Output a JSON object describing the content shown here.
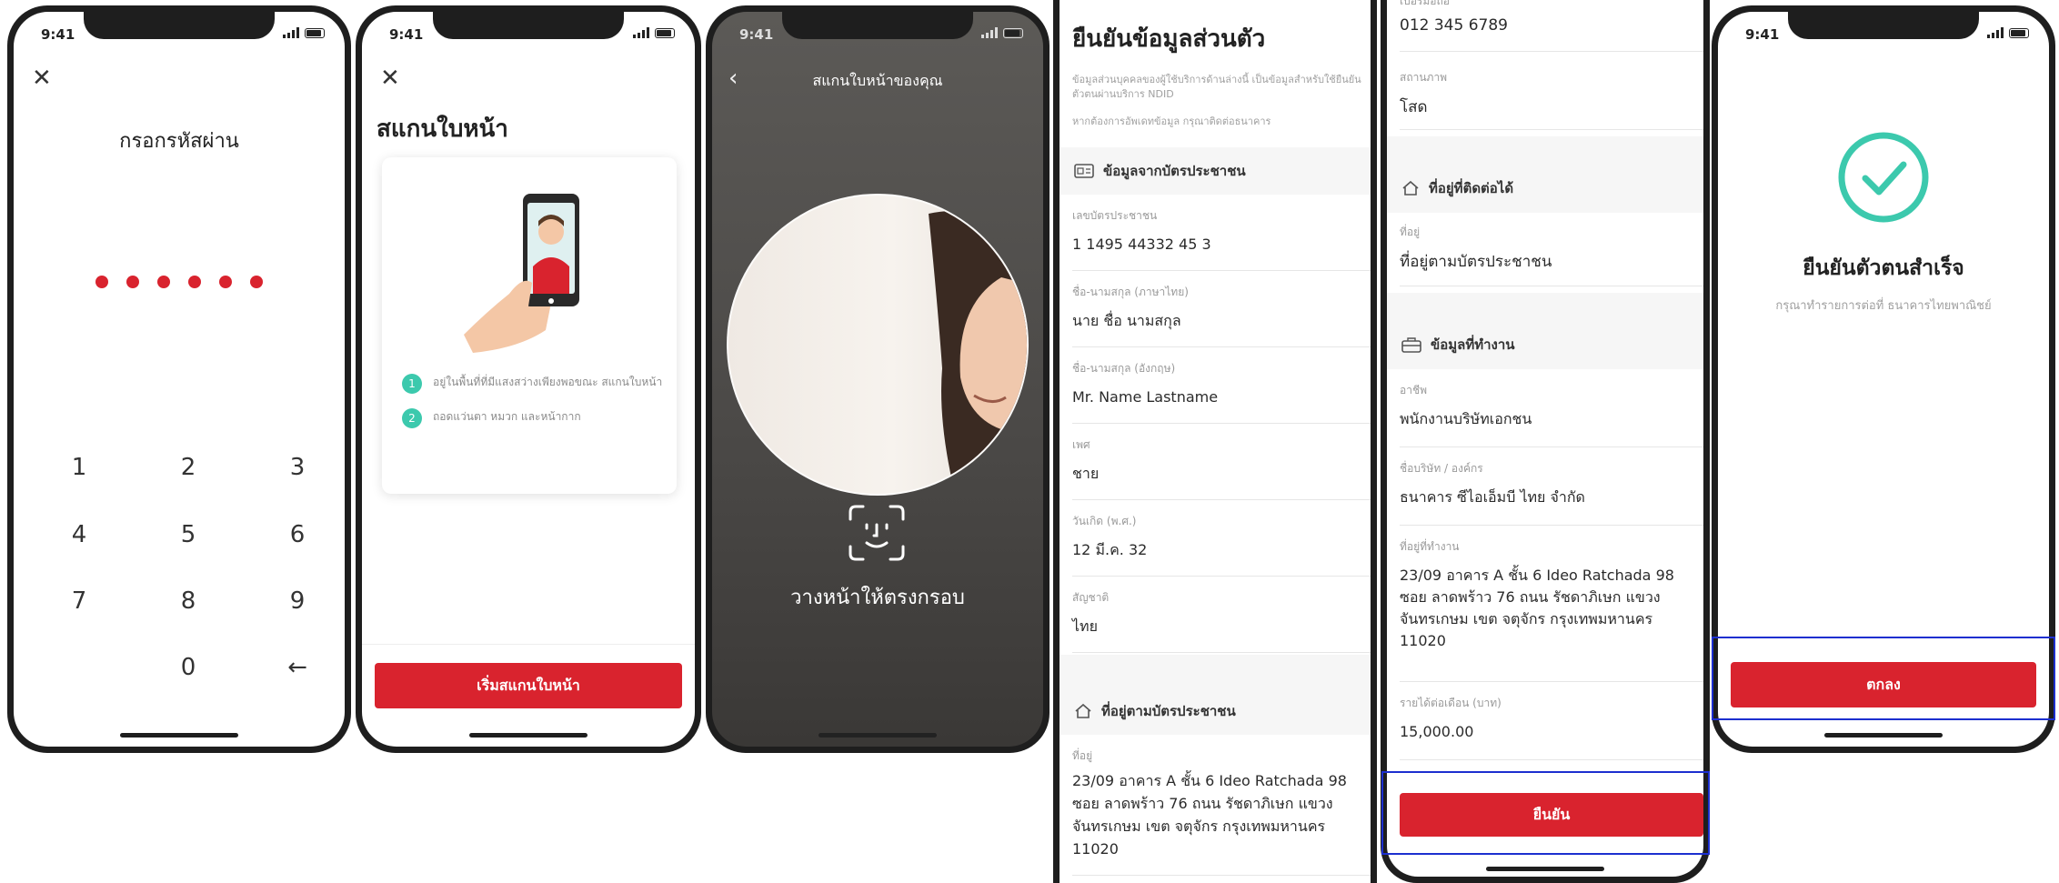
{
  "status_bar": {
    "time": "9:41"
  },
  "screen1": {
    "title": "กรอกรหัสผ่าน",
    "pin_dot_count": 6,
    "keys": [
      "1",
      "2",
      "3",
      "4",
      "5",
      "6",
      "7",
      "8",
      "9",
      "0"
    ],
    "backspace_glyph": "←"
  },
  "screen2": {
    "title": "สแกนใบหน้า",
    "steps": [
      {
        "num": "1",
        "text": "อยู่ในพื้นที่ที่มีแสงสว่างเพียงพอขณะ สแกนใบหน้า"
      },
      {
        "num": "2",
        "text": "ถอดแว่นตา หมวก และหน้ากาก"
      }
    ],
    "button": "เริ่มสแกนใบหน้า"
  },
  "screen3": {
    "title": "สแกนใบหน้าของคุณ",
    "instruction": "วางหน้าให้ตรงกรอบ"
  },
  "screen4": {
    "title": "ยืนยันข้อมูลส่วนตัว",
    "desc": "ข้อมูลส่วนบุคคลของผู้ใช้บริการด้านล่างนี้ เป็นข้อมูลสำหรับใช้ยืนยันตัวตนผ่านบริการ NDID",
    "note": "หากต้องการอัพเดทข้อมูล กรุณาติดต่อธนาคาร",
    "id_card_section": "ข้อมูลจากบัตรประชาชน",
    "fields": [
      {
        "label": "เลขบัตรประชาชน",
        "value": "1 1495 44332 45 3"
      },
      {
        "label": "ชื่อ-นามสกุล (ภาษาไทย)",
        "value": "นาย ชื่อ นามสกุล"
      },
      {
        "label": "ชื่อ-นามสกุล (อังกฤษ)",
        "value": "Mr. Name Lastname"
      },
      {
        "label": "เพศ",
        "value": "ชาย"
      },
      {
        "label": "วันเกิด (พ.ศ.)",
        "value": "12 มี.ค. 32"
      },
      {
        "label": "สัญชาติ",
        "value": "ไทย"
      }
    ],
    "address_section": "ที่อยู่ตามบัตรประชาชน",
    "address_label": "ที่อยู่",
    "address_value": "23/09 อาคาร A ชั้น 6 Ideo Ratchada 98 ซอย ลาดพร้าว 76 ถนน รัชดาภิเษก แขวง จันทรเกษม เขต จตุจักร กรุงเทพมหานคร 11020"
  },
  "screen5": {
    "phone_label": "เบอร์มือถือ",
    "phone_value": "012 345 6789",
    "status_label": "สถานภาพ",
    "status_value": "โสด",
    "contact_section": "ที่อยู่ที่ติดต่อได้",
    "contact_label": "ที่อยู่",
    "contact_value": "ที่อยู่ตามบัตรประชาชน",
    "work_section": "ข้อมูลที่ทำงาน",
    "work_fields": [
      {
        "label": "อาชีพ",
        "value": "พนักงานบริษัทเอกชน"
      },
      {
        "label": "ชื่อบริษัท / องค์กร",
        "value": "ธนาคาร ซีไอเอ็มบี ไทย จำกัด"
      },
      {
        "label": "ที่อยู่ที่ทำงาน",
        "value": "23/09 อาคาร A ชั้น 6 Ideo Ratchada 98 ซอย ลาดพร้าว 76 ถนน รัชดาภิเษก แขวง จันทรเกษม เขต จตุจักร กรุงเทพมหานคร 11020"
      },
      {
        "label": "รายได้ต่อเดือน (บาท)",
        "value": "15,000.00"
      }
    ],
    "button": "ยืนยัน"
  },
  "screen6": {
    "title": "ยืนยันตัวตนสำเร็จ",
    "subtitle": "กรุณาทำรายการต่อที่ ธนาคารไทยพาณิชย์",
    "button": "ตกลง"
  },
  "colors": {
    "brand_red": "#d9232e",
    "success_teal": "#3cc9ad",
    "highlight_blue": "#1c2fcf"
  },
  "icons": {
    "close": "close-icon",
    "back": "chevron-left-icon",
    "faceid": "face-id-icon",
    "check": "check-circle-icon",
    "id_card": "id-card-icon",
    "home": "home-icon",
    "briefcase": "briefcase-icon"
  }
}
